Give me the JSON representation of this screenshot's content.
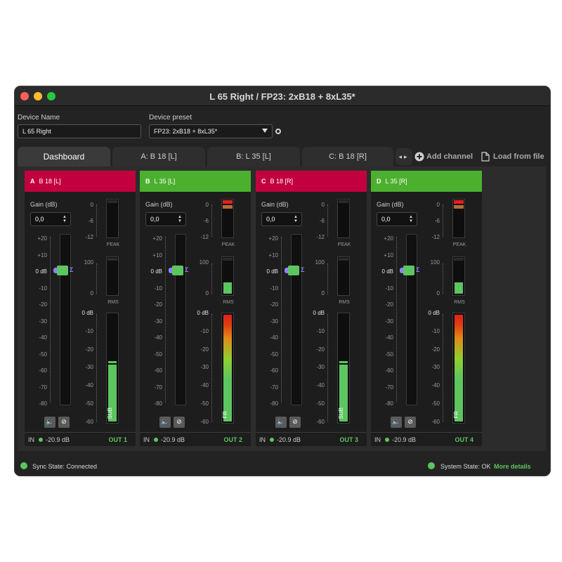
{
  "window": {
    "title": "L 65 Right / FP23: 2xB18 + 8xL35*"
  },
  "device": {
    "name_label": "Device Name",
    "name_value": "L 65 Right",
    "preset_label": "Device preset",
    "preset_value": "FP23: 2xB18 + 8xL35*"
  },
  "tabs": [
    {
      "label": "Dashboard",
      "active": true
    },
    {
      "label": "A: B 18 [L]"
    },
    {
      "label": "B: L 35 [L]"
    },
    {
      "label": "C: B 18 [R]"
    }
  ],
  "toolbar": {
    "add_channel": "Add channel",
    "load_from_file": "Load from file"
  },
  "common": {
    "gain_label": "Gain (dB)",
    "gain_value": "0,0",
    "zero_db": "0 dB",
    "fader_ticks": [
      "+20",
      "+10",
      "0 dB",
      "-10",
      "-20",
      "-30",
      "-40",
      "-50",
      "-60",
      "-70",
      "-80"
    ],
    "peak_ticks": [
      "0",
      "-6",
      "-12"
    ],
    "rms_ticks": [
      "100",
      "0"
    ],
    "peak_label": "PEAK",
    "rms_label": "RMS",
    "out_ticks": [
      "0 dB",
      "-10",
      "-20",
      "-30",
      "-40",
      "-50",
      "-60"
    ],
    "in_label": "IN",
    "in_value": "-20.9 dB",
    "sigma": "Σ"
  },
  "channels": [
    {
      "letter": "A",
      "name": "B 18 [L]",
      "color": "#c3003f",
      "out_name": "SUB",
      "out_label": "OUT 1",
      "peak_active": false,
      "rms_level": 0.0,
      "out_level": 0.53
    },
    {
      "letter": "B",
      "name": "L 35 [L]",
      "color": "#4cb02f",
      "out_name": "FR",
      "out_label": "OUT 2",
      "peak_active": true,
      "rms_level": 0.3,
      "out_level": 1.0
    },
    {
      "letter": "C",
      "name": "B 18 [R]",
      "color": "#c3003f",
      "out_name": "SUB",
      "out_label": "OUT 3",
      "peak_active": false,
      "rms_level": 0.0,
      "out_level": 0.53
    },
    {
      "letter": "D",
      "name": "L 35 [R]",
      "color": "#4cb02f",
      "out_name": "FR",
      "out_label": "OUT 4",
      "peak_active": true,
      "rms_level": 0.3,
      "out_level": 1.0
    }
  ],
  "status": {
    "sync": "Sync State: Connected",
    "system": "System State: OK",
    "more_details": "More details"
  },
  "colors": {
    "green": "#5dc55f",
    "red": "#c3003f",
    "peak_red": "#e02020",
    "peak_orange": "#b86a3a"
  }
}
